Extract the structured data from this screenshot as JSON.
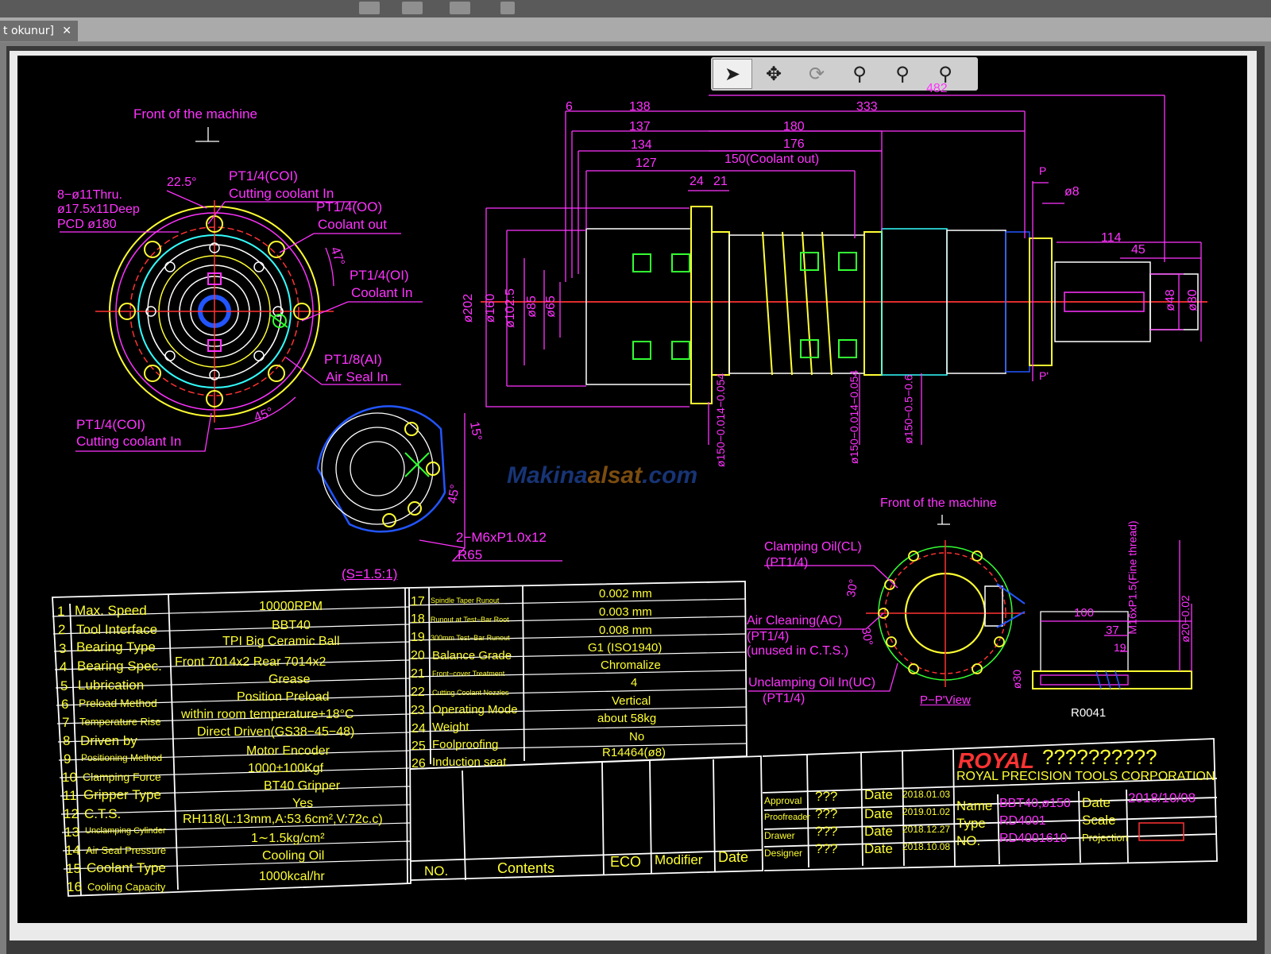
{
  "tab": {
    "label": "t okunur]",
    "close": "✕"
  },
  "toolbar": {
    "tools": [
      "select-tool",
      "pan-tool",
      "rotate-tool",
      "zoom-in-tool",
      "zoom-window-tool",
      "zoom-tool"
    ]
  },
  "watermark": {
    "part1": "Makina",
    "part2": "alsat",
    "part3": ".com"
  },
  "drawing": {
    "front_label_left": "Front  of  the  machine",
    "front_label_right": "Front  of  the  machine",
    "holes_label": [
      "8−ø11Thru.",
      "ø17.5x11Deep",
      "PCD  ø180"
    ],
    "angle_22": "22.5°",
    "angle_47": "47°",
    "angle_45": "45°",
    "angle_15": "15°",
    "angle_45b": "45°",
    "angle_30a": "30°",
    "angle_30b": "30°",
    "port_coi_top": [
      "PT1/4(COI)",
      "Cutting  coolant  In"
    ],
    "port_co": [
      "PT1/4(OO)",
      "Coolant  out"
    ],
    "port_oi": [
      "PT1/4(OI)",
      "Coolant  In"
    ],
    "port_ai": [
      "PT1/8(AI)",
      "Air  Seal  In"
    ],
    "port_coi_bottom": [
      "PT1/4(COI)",
      "Cutting  coolant  In"
    ],
    "m6_label": [
      "2−M6xP1.0x12",
      "R65"
    ],
    "scale_label": "(S=1.5:1)",
    "dims_top": [
      "6",
      "138",
      "333",
      "482",
      "137",
      "180",
      "134",
      "176",
      "127",
      "150(Coolant  out)",
      "24",
      "21"
    ],
    "dims_left": [
      "ø202",
      "ø160",
      "ø102.5",
      "ø85",
      "ø65"
    ],
    "dims_bottom": [
      "ø150−0.014−0.054",
      "ø150−0.014−0.054",
      "ø150−0.5−0.6"
    ],
    "dims_right": [
      "P",
      "ø8",
      "114",
      "45",
      "ø48",
      "ø80",
      "P'"
    ],
    "clamp_oil": [
      "Clamping  Oil(CL)",
      "(PT1/4)"
    ],
    "air_clean": [
      "Air  Cleaning(AC)",
      "(PT1/4)",
      "(unused  in  C.T.S.)"
    ],
    "unclamp": [
      "Unclamping  Oil  In(UC)",
      "(PT1/4)"
    ],
    "pp_view": "P−P'View",
    "r0041": [
      "100",
      "37",
      "19",
      "M16xP1.5(Fine  thread)",
      "ø20−0.02",
      "ø30",
      "R0041"
    ]
  },
  "spec_left": [
    {
      "no": "1",
      "item": "Max.  Speed",
      "value": "10000RPM"
    },
    {
      "no": "2",
      "item": "Tool  Interface",
      "value": "BBT40"
    },
    {
      "no": "3",
      "item": "Bearing  Type",
      "value": "TPI  Big  Ceramic  Ball"
    },
    {
      "no": "4",
      "item": "Bearing  Spec.",
      "value": "Front    7014x2    Rear    7014x2"
    },
    {
      "no": "5",
      "item": "Lubrication",
      "value": "Grease"
    },
    {
      "no": "6",
      "item": "Preload  Method",
      "value": "Position  Preload"
    },
    {
      "no": "7",
      "item": "Temperature  Rise",
      "value": "within  room  temperature+18°C"
    },
    {
      "no": "8",
      "item": "Driven  by",
      "value": "Direct  Driven(GS38−45−48)"
    },
    {
      "no": "9",
      "item": "Positioning  Method",
      "value": "Motor  Encoder"
    },
    {
      "no": "10",
      "item": "Clamping  Force",
      "value": "1000±100Kgf"
    },
    {
      "no": "11",
      "item": "Gripper  Type",
      "value": "BT40  Gripper"
    },
    {
      "no": "12",
      "item": "C.T.S.",
      "value": "Yes"
    },
    {
      "no": "13",
      "item": "Unclamping  Cylinder",
      "value": "RH118(L:13mm,A:53.6cm²,V:72c.c)"
    },
    {
      "no": "14",
      "item": "Air  Seal  Pressure",
      "value": "1∼1.5kg/cm²"
    },
    {
      "no": "15",
      "item": "Coolant  Type",
      "value": "Cooling  Oil"
    },
    {
      "no": "16",
      "item": "Cooling  Capacity",
      "value": "1000kcal/hr"
    }
  ],
  "spec_right": [
    {
      "no": "17",
      "item": "Spindle  Taper  Runout",
      "value": "0.002  mm"
    },
    {
      "no": "18",
      "item": "Runout  at  Test−Bar  Root",
      "value": "0.003  mm"
    },
    {
      "no": "19",
      "item": "300mm  Test−Bar  Runout",
      "value": "0.008  mm"
    },
    {
      "no": "20",
      "item": "Balance  Grade",
      "value": "G1  (ISO1940)"
    },
    {
      "no": "21",
      "item": "Front−cover  Treatment",
      "value": "Chromalize"
    },
    {
      "no": "22",
      "item": "Cutting  Coolant  Nozzles",
      "value": "4"
    },
    {
      "no": "23",
      "item": "Operating  Mode",
      "value": "Vertical"
    },
    {
      "no": "24",
      "item": "Weight",
      "value": "about  58kg"
    },
    {
      "no": "25",
      "item": "Foolproofing",
      "value": "No"
    },
    {
      "no": "26",
      "item": "Induction  seat",
      "value": "R14464(ø8)"
    }
  ],
  "revision": {
    "headers": [
      "NO.",
      "Contents",
      "ECO",
      "Modifier",
      "Date"
    ]
  },
  "signoff": [
    {
      "role": "Approval",
      "name": "???",
      "date_label": "Date",
      "date": "2018.01.03"
    },
    {
      "role": "Proofreader",
      "name": "???",
      "date_label": "Date",
      "date": "2019.01.02"
    },
    {
      "role": "Drawer",
      "name": "???",
      "date_label": "Date",
      "date": "2018.12.27"
    },
    {
      "role": "Designer",
      "name": "???",
      "date_label": "Date",
      "date": "2018.10.08"
    }
  ],
  "title_block": {
    "logo": "ROYAL",
    "logo_tail": "??????????",
    "company": "ROYAL  PRECISION  TOOLS  CORPORATION",
    "name_label": "Name",
    "name": "BBT40,ø150",
    "type_label": "Type",
    "type": "RD4001",
    "no_label": "NO.",
    "no": "RD4001610",
    "date_label": "Date",
    "date": "2018/10/08",
    "scale_label": "Scale",
    "projection_label": "Projection"
  }
}
